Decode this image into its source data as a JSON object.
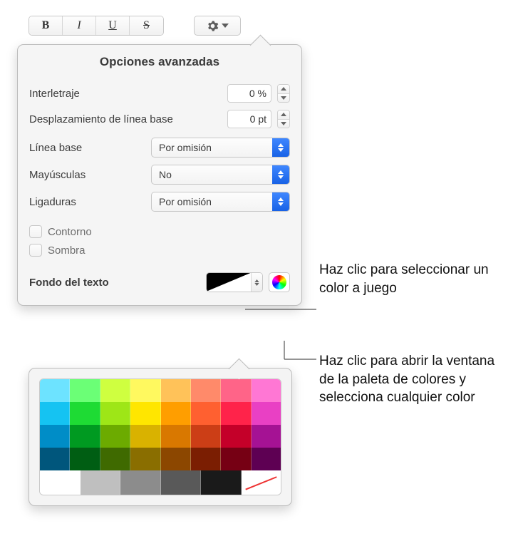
{
  "toolbar": {
    "bold": "B",
    "italic": "I",
    "underline": "U",
    "strike": "S"
  },
  "popover": {
    "title": "Opciones avanzadas",
    "tracking_label": "Interletraje",
    "tracking_value": "0 %",
    "baseline_shift_label": "Desplazamiento de línea base",
    "baseline_shift_value": "0 pt",
    "baseline_label": "Línea base",
    "baseline_value": "Por omisión",
    "caps_label": "Mayúsculas",
    "caps_value": "No",
    "ligatures_label": "Ligaduras",
    "ligatures_value": "Por omisión",
    "outline_label": "Contorno",
    "shadow_label": "Sombra",
    "textbg_label": "Fondo del texto"
  },
  "color_grid": {
    "rows": [
      [
        "#6de3ff",
        "#6bff76",
        "#cfff40",
        "#fff95f",
        "#ffc259",
        "#ff8a6a",
        "#ff6488",
        "#ff77d4"
      ],
      [
        "#15c3f2",
        "#1edb34",
        "#9ee617",
        "#ffe600",
        "#ff9e00",
        "#ff6030",
        "#ff234a",
        "#e940c4"
      ],
      [
        "#008dc7",
        "#009a21",
        "#6cab00",
        "#d9b200",
        "#d97800",
        "#cc3e16",
        "#c40029",
        "#a51294"
      ],
      [
        "#00567c",
        "#005e13",
        "#3f6a00",
        "#8a6e00",
        "#8c4700",
        "#7b1e02",
        "#760014",
        "#5e0053"
      ]
    ],
    "neutrals": [
      "#ffffff",
      "#bfbfbf",
      "#8c8c8c",
      "#595959",
      "#1a1a1a",
      "none"
    ]
  },
  "callouts": {
    "swatch": "Haz clic para seleccionar un color a juego",
    "wheel": "Haz clic para abrir la ventana de la paleta de colores y selecciona cualquier color"
  }
}
